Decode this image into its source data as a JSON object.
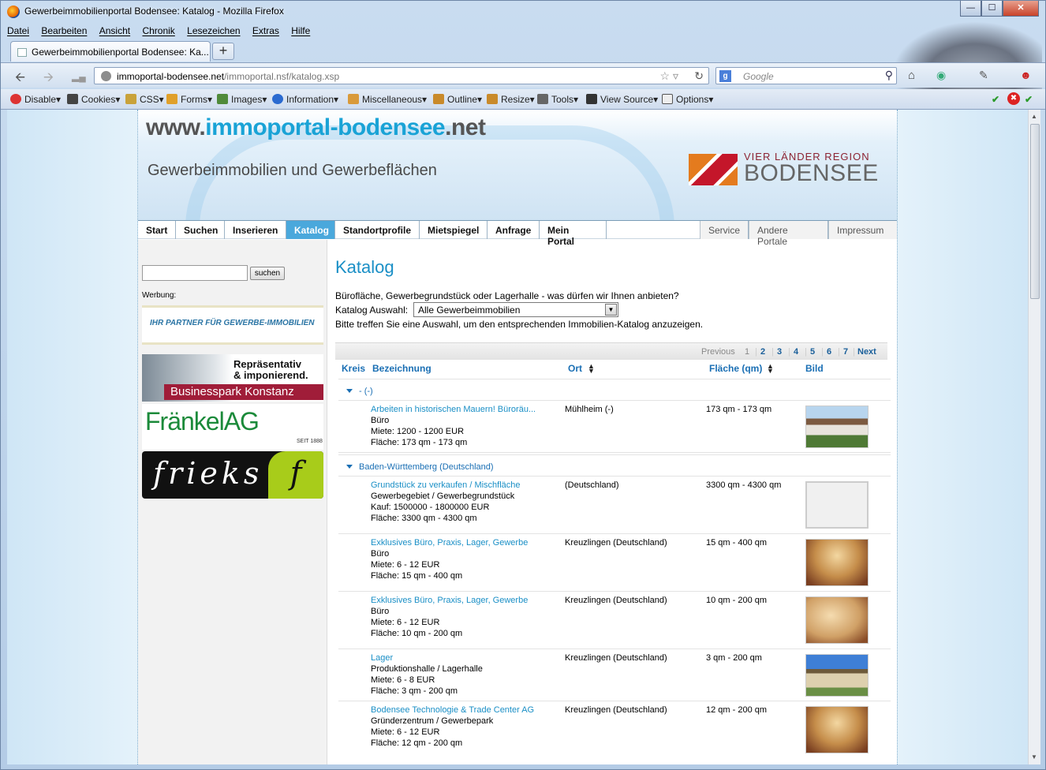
{
  "window": {
    "title": "Gewerbeimmobilienportal Bodensee: Katalog - Mozilla Firefox",
    "min": "—",
    "max": "☐",
    "close": "✕"
  },
  "menu": [
    "Datei",
    "Bearbeiten",
    "Ansicht",
    "Chronik",
    "Lesezeichen",
    "Extras",
    "Hilfe"
  ],
  "tab": {
    "label": "Gewerbeimmobilienportal Bodensee: Ka...",
    "new": "+"
  },
  "nav": {
    "url_domain": "immoportal-bodensee.net",
    "url_path": "/immoportal.nsf/katalog.xsp",
    "search_placeholder": "Google"
  },
  "devtoolbar": [
    "Disable▾",
    "Cookies▾",
    "CSS▾",
    "Forms▾",
    "Images▾",
    "Information▾",
    "Miscellaneous▾",
    "Outline▾",
    "Resize▾",
    "Tools▾",
    "View Source▾",
    "Options▾"
  ],
  "site": {
    "title_pre": "www.",
    "title_main": "immoportal-bodensee",
    "title_post": ".net",
    "subtitle": "Gewerbeimmobilien und Gewerbeflächen",
    "logo_line1": "VIER LÄNDER REGION",
    "logo_line2": "BODENSEE"
  },
  "mainnav": [
    "Start",
    "Suchen",
    "Inserieren",
    "Katalog",
    "Standortprofile",
    "Mietspiegel",
    "Anfrage",
    "Mein Portal"
  ],
  "secnav": [
    "Service",
    "Andere Portale",
    "Impressum"
  ],
  "sidebar": {
    "search_button": "suchen",
    "werbung": "Werbung:",
    "ad1": "IHR PARTNER FÜR GEWERBE-IMMOBILIEN",
    "ad2_line1": "Repräsentativ",
    "ad2_line2": "& imponierend.",
    "ad2_line3": "Businesspark Konstanz",
    "ad3": "FränkelAG",
    "ad3_small": "SEIT 1888",
    "ad4": "frieks",
    "ad4_f": "f"
  },
  "main": {
    "title": "Katalog",
    "intro": "Bürofläche, Gewerbegrundstück oder Lagerhalle - was dürfen wir Ihnen anbieten?",
    "select_label": "Katalog Auswahl:",
    "select_value": "Alle Gewerbeimmobilien",
    "hint": "Bitte treffen Sie eine Auswahl, um den entsprechenden Immobilien-Katalog anzuzeigen.",
    "pager": {
      "prev": "Previous",
      "current": "1",
      "pages": [
        "2",
        "3",
        "4",
        "5",
        "6",
        "7"
      ],
      "next": "Next"
    },
    "columns": {
      "kreis": "Kreis",
      "bezeichnung": "Bezeichnung",
      "ort": "Ort",
      "flaeche": "Fläche (qm)",
      "bild": "Bild"
    },
    "groups": [
      "- (-)",
      "Baden-Württemberg (Deutschland)"
    ],
    "rows": [
      {
        "title": "Arbeiten in historischen Mauern! Büroräu...",
        "type": "Büro",
        "price": "Miete: 1200 - 1200 EUR",
        "area": "Fläche: 173 qm - 173 qm",
        "ort": "Mühlheim (-)",
        "flaeche": "173 qm - 173 qm"
      },
      {
        "title": "Grundstück zu verkaufen / Mischfläche",
        "type": "Gewerbegebiet / Gewerbegrundstück",
        "price": "Kauf: 1500000 - 1800000 EUR",
        "area": "Fläche: 3300 qm - 4300 qm",
        "ort": "(Deutschland)",
        "flaeche": "3300 qm - 4300 qm"
      },
      {
        "title": "Exklusives Büro, Praxis, Lager, Gewerbe",
        "type": "Büro",
        "price": "Miete: 6 - 12 EUR",
        "area": "Fläche: 15 qm - 400 qm",
        "ort": "Kreuzlingen (Deutschland)",
        "flaeche": "15 qm - 400 qm"
      },
      {
        "title": "Exklusives Büro, Praxis, Lager, Gewerbe",
        "type": "Büro",
        "price": "Miete: 6 - 12 EUR",
        "area": "Fläche: 10 qm - 200 qm",
        "ort": "Kreuzlingen (Deutschland)",
        "flaeche": "10 qm - 200 qm"
      },
      {
        "title": "Lager",
        "type": "Produktionshalle / Lagerhalle",
        "price": "Miete: 6 - 8 EUR",
        "area": "Fläche: 3 qm - 200 qm",
        "ort": "Kreuzlingen (Deutschland)",
        "flaeche": "3 qm - 200 qm"
      },
      {
        "title": "Bodensee Technologie & Trade Center AG",
        "type": "Gründerzentrum / Gewerbepark",
        "price": "Miete: 6 - 12 EUR",
        "area": "Fläche: 12 qm - 200 qm",
        "ort": "Kreuzlingen (Deutschland)",
        "flaeche": "12 qm - 200 qm"
      }
    ]
  }
}
